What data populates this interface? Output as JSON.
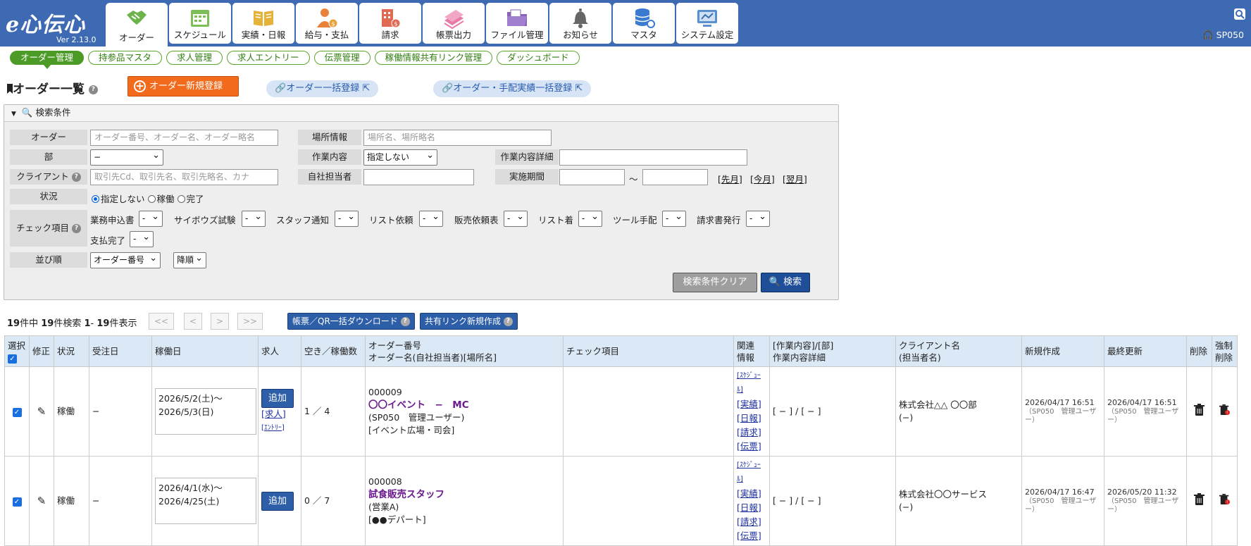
{
  "app": {
    "logo": "e心伝心",
    "version": "Ver 2.13.0",
    "user": "SP050"
  },
  "nav": {
    "tabs": [
      {
        "label": "オーダー",
        "icon": "handshake-icon"
      },
      {
        "label": "スケジュール",
        "icon": "calendar-icon"
      },
      {
        "label": "実績・日報",
        "icon": "book-icon"
      },
      {
        "label": "給与・支払",
        "icon": "person-money-icon"
      },
      {
        "label": "請求",
        "icon": "building-money-icon"
      },
      {
        "label": "帳票出力",
        "icon": "papers-icon"
      },
      {
        "label": "ファイル管理",
        "icon": "folder-icon"
      },
      {
        "label": "お知らせ",
        "icon": "bell-icon"
      },
      {
        "label": "マスタ",
        "icon": "database-icon"
      },
      {
        "label": "システム設定",
        "icon": "system-settings-icon"
      }
    ]
  },
  "subnav": [
    "オーダー管理",
    "持参品マスタ",
    "求人管理",
    "求人エントリー",
    "伝票管理",
    "稼働情報共有リンク管理",
    "ダッシュボード"
  ],
  "page": {
    "title": "オーダー一覧",
    "new_button": "オーダー新規登録",
    "bulk_register": "オーダー一括登録",
    "bulk_register2": "オーダー・手配実績一括登録"
  },
  "search": {
    "header": "検索条件",
    "order_label": "オーダー",
    "order_placeholder": "オーダー番号、オーダー名、オーダー略名",
    "place_label": "場所情報",
    "place_placeholder": "場所名、場所略名",
    "dept_label": "部",
    "dept_value": "−",
    "work_label": "作業内容",
    "work_value": "指定しない",
    "work_detail_label": "作業内容詳細",
    "client_label": "クライアント",
    "client_placeholder": "取引先Cd、取引先名、取引先略名、カナ",
    "staff_label": "自社担当者",
    "period_label": "実施期間",
    "tilde": "〜",
    "prev_month": "[先月]",
    "this_month": "[今月]",
    "next_month": "[翌月]",
    "status_label": "状況",
    "status_options": [
      "指定しない",
      "稼働",
      "完了"
    ],
    "check_label": "チェック項目",
    "checks": [
      "業務申込書",
      "サイボウズ試験",
      "スタッフ通知",
      "リスト依頼",
      "販売依頼表",
      "リスト着",
      "ツール手配",
      "請求書発行",
      "支払完了"
    ],
    "dash": "-",
    "sort_label": "並び順",
    "sort_value": "オーダー番号",
    "sort_dir": "降順",
    "clear": "検索条件クリア",
    "submit": "検索"
  },
  "results": {
    "total": "19",
    "found": "19",
    "from": "1",
    "to": "19",
    "t1": "件中",
    "t2": "件検索",
    "t3": "件表示",
    "dash_sep": "-",
    "pager": [
      "<<",
      "<",
      ">",
      ">>"
    ],
    "download_btn": "帳票／QR一括ダウンロード",
    "share_btn": "共有リンク新規作成"
  },
  "table": {
    "headers": {
      "select": "選択",
      "edit": "修正",
      "status": "状況",
      "received": "受注日",
      "work_date": "稼働日",
      "recruit": "求人",
      "vacancy": "空き／稼働数",
      "order_no": "オーダー番号",
      "order_sub": "オーダー名(自社担当者)[場所名]",
      "check": "チェック項目",
      "related1": "関連",
      "related2": "情報",
      "work1": "[作業内容]/[部]",
      "work2": "作業内容詳細",
      "client1": "クライアント名",
      "client2": "(担当者名)",
      "created": "新規作成",
      "updated": "最終更新",
      "delete": "削除",
      "fdel1": "強制",
      "fdel2": "削除"
    },
    "rows": [
      {
        "status": "稼働",
        "received": "−",
        "date1": "2026/5/2(土)〜",
        "date2": "2026/5/3(日)",
        "add": "追加",
        "recruit": "[求人]",
        "entry": "[ｴﾝﾄﾘｰ]",
        "vacancy": "1 ／ 4",
        "no": "000009",
        "name": "〇〇イベント　−　MC",
        "staff": "(SP050　管理ユーザー)",
        "place": "[イベント広場・司会]",
        "rel": [
          "[ｽｹｼﾞｭｰﾙ]",
          "[実績]",
          "[日報]",
          "[請求]",
          "[伝票]"
        ],
        "work": "[ − ] / [ − ]",
        "client": "株式会社△△ 〇〇部",
        "client_staff": "(−)",
        "created": "2026/04/17 16:51",
        "created_by": "（SP050　管理ユーザー）",
        "updated": "2026/04/17 16:51",
        "updated_by": "（SP050　管理ユーザー）"
      },
      {
        "status": "稼働",
        "received": "−",
        "date1": "2026/4/1(水)〜",
        "date2": "2026/4/25(土)",
        "add": "追加",
        "recruit": "",
        "entry": "",
        "vacancy": "0 ／ 7",
        "no": "000008",
        "name": "試食販売スタッフ",
        "staff": "(営業A)",
        "place": "[●●デパート]",
        "rel": [
          "[ｽｹｼﾞｭｰﾙ]",
          "[実績]",
          "[日報]",
          "[請求]",
          "[伝票]"
        ],
        "work": "[ − ] / [ − ]",
        "client": "株式会社〇〇サービス",
        "client_staff": "(−)",
        "created": "2026/04/17 16:47",
        "created_by": "（SP050　管理ユーザー）",
        "updated": "2026/05/20 11:32",
        "updated_by": "（SP050　管理ユーザー）"
      }
    ]
  }
}
